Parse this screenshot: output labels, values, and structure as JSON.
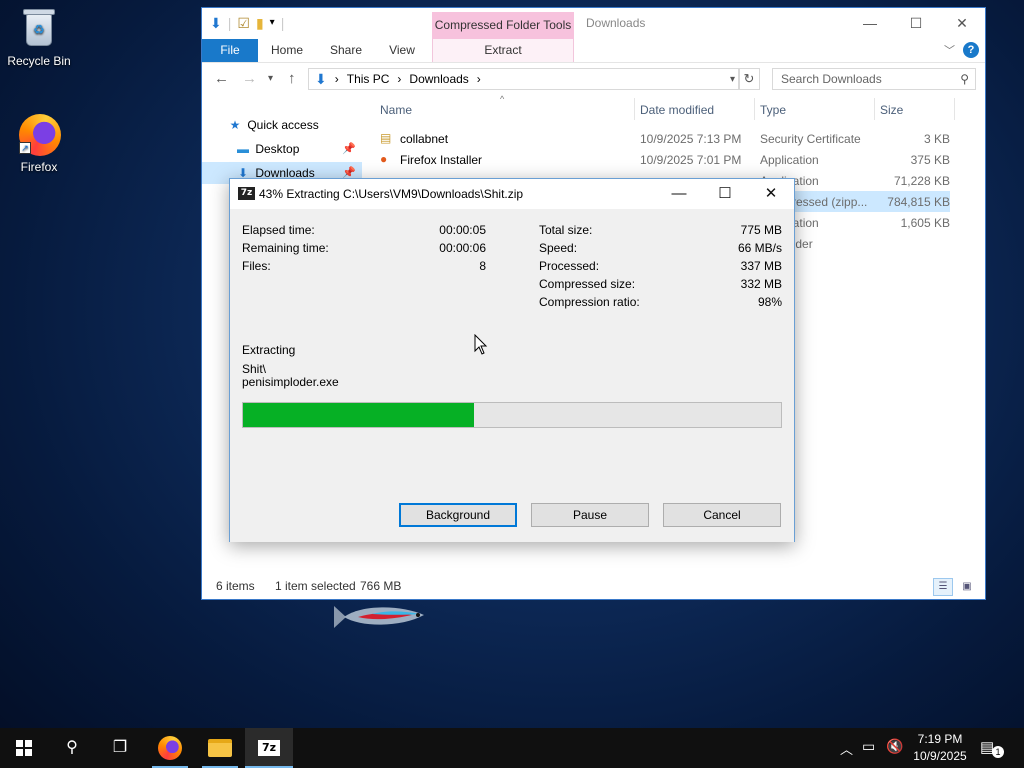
{
  "desktop": {
    "icons": [
      {
        "label": "Recycle Bin",
        "icon": "recycle-bin-icon"
      },
      {
        "label": "Firefox",
        "icon": "firefox-icon"
      }
    ]
  },
  "explorer": {
    "title": "Downloads",
    "context_tab": "Compressed Folder Tools",
    "ribbon_tabs": [
      "File",
      "Home",
      "Share",
      "View",
      "Extract"
    ],
    "breadcrumb": [
      "This PC",
      "Downloads"
    ],
    "search_placeholder": "Search Downloads",
    "nav": [
      {
        "label": "Quick access",
        "icon": "star-icon"
      },
      {
        "label": "Desktop",
        "icon": "desktop-icon"
      },
      {
        "label": "Downloads",
        "icon": "download-arrow-icon"
      }
    ],
    "columns": [
      "Name",
      "Date modified",
      "Type",
      "Size"
    ],
    "rows": [
      {
        "name": "collabnet",
        "date": "10/9/2025 7:13 PM",
        "type": "Security Certificate",
        "size": "3 KB"
      },
      {
        "name": "Firefox Installer",
        "date": "10/9/2025 7:01 PM",
        "type": "Application",
        "size": "375 KB"
      },
      {
        "name": "",
        "date": "",
        "type": "Application",
        "size": "71,228 KB"
      },
      {
        "name": "",
        "date": "",
        "type": "Compressed (zipp...",
        "size": "784,815 KB"
      },
      {
        "name": "",
        "date": "",
        "type": "Application",
        "size": "1,605 KB"
      },
      {
        "name": "",
        "date": "",
        "type": "File folder",
        "size": ""
      }
    ],
    "status": {
      "items": "6 items",
      "selected": "1 item selected",
      "selected_size": "766 MB"
    }
  },
  "zip_dialog": {
    "title": "43% Extracting C:\\Users\\VM9\\Downloads\\Shit.zip",
    "progress": 0.43,
    "left_stats": [
      {
        "label": "Elapsed time:",
        "value": "00:00:05"
      },
      {
        "label": "Remaining time:",
        "value": "00:00:06"
      },
      {
        "label": "Files:",
        "value": "8"
      }
    ],
    "right_stats": [
      {
        "label": "Total size:",
        "value": "775 MB"
      },
      {
        "label": "Speed:",
        "value": "66 MB/s"
      },
      {
        "label": "Processed:",
        "value": "337 MB"
      },
      {
        "label": "Compressed size:",
        "value": "332 MB"
      },
      {
        "label": "Compression ratio:",
        "value": "98%"
      }
    ],
    "status_label": "Extracting",
    "current_path_line1": "Shit\\",
    "current_path_line2": "penisimploder.exe",
    "buttons": {
      "background": "Background",
      "pause": "Pause",
      "cancel": "Cancel"
    },
    "logo_text": "7z"
  },
  "taskbar": {
    "clock_time": "7:19 PM",
    "clock_date": "10/9/2025",
    "zip_label": "7z",
    "notification_count": "1"
  },
  "colors": {
    "progress_fill": "#06b025",
    "accent": "#1979ca",
    "context_tab": "#f7c2dd"
  }
}
